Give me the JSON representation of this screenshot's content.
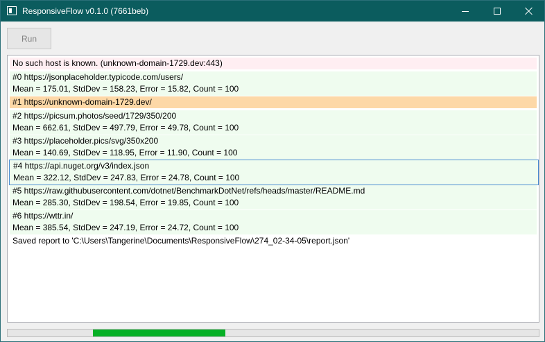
{
  "window": {
    "title": "ResponsiveFlow v0.1.0 (7661beb)"
  },
  "toolbar": {
    "run_label": "Run"
  },
  "log": {
    "error_line": "No such host is known. (unknown-domain-1729.dev:443)",
    "entries": [
      {
        "url": "#0 https://jsonplaceholder.typicode.com/users/",
        "stats": "Mean = 175.01, StdDev = 158.23, Error = 15.82, Count = 100"
      },
      {
        "url": "#1 https://unknown-domain-1729.dev/"
      },
      {
        "url": "#2 https://picsum.photos/seed/1729/350/200",
        "stats": "Mean = 662.61, StdDev = 497.79, Error = 49.78, Count = 100"
      },
      {
        "url": "#3 https://placeholder.pics/svg/350x200",
        "stats": "Mean = 140.69, StdDev = 118.95, Error = 11.90, Count = 100"
      },
      {
        "url": "#4 https://api.nuget.org/v3/index.json",
        "stats": "Mean = 322.12, StdDev = 247.83, Error = 24.78, Count = 100"
      },
      {
        "url": "#5 https://raw.githubusercontent.com/dotnet/BenchmarkDotNet/refs/heads/master/README.md",
        "stats": "Mean = 285.30, StdDev = 198.54, Error = 19.85, Count = 100"
      },
      {
        "url": "#6 https://wttr.in/",
        "stats": "Mean = 385.54, StdDev = 247.19, Error = 24.72, Count = 100"
      }
    ],
    "saved_line": "Saved report to 'C:\\Users\\Tangerine\\Documents\\ResponsiveFlow\\274_02-34-05\\report.json'"
  },
  "progress": {
    "start_fraction": 0.16,
    "end_fraction": 0.41,
    "color": "#06b025"
  },
  "colors": {
    "titlebar": "#0b5c5e",
    "error_row": "#ffeef2",
    "ok_row": "#effcef",
    "warn_row": "#fdd8a7",
    "selection_border": "#4a8bd2"
  }
}
